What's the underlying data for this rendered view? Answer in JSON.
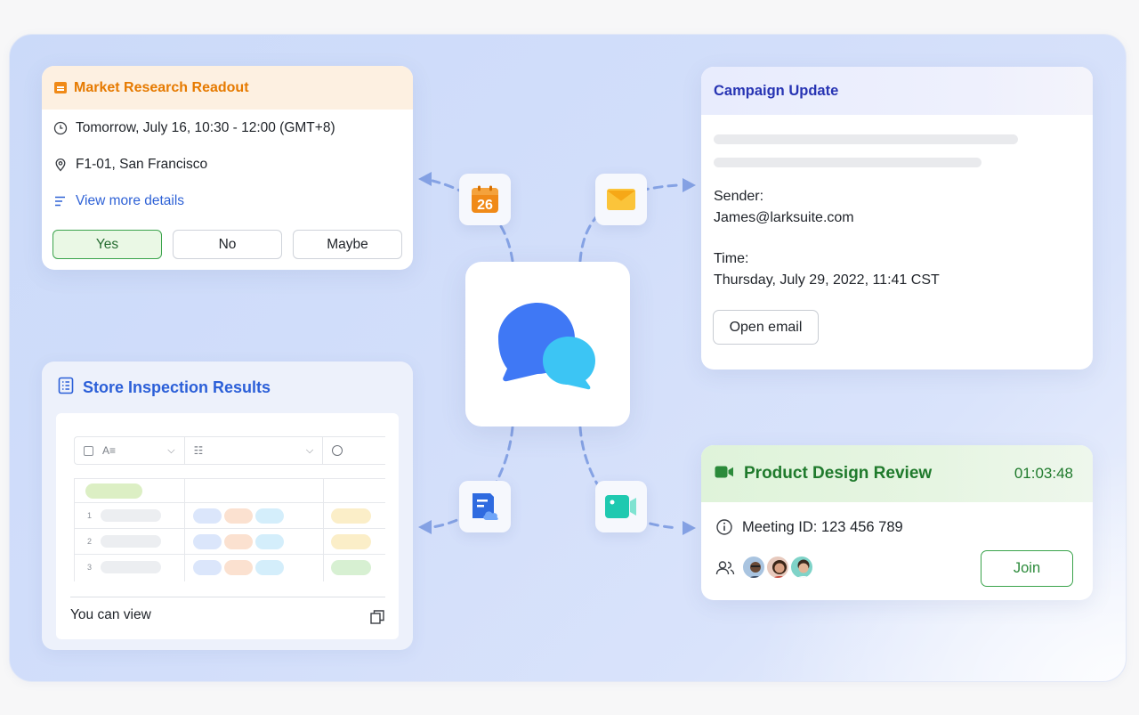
{
  "market_research": {
    "title": "Market Research Readout",
    "time": "Tomorrow, July 16, 10:30 - 12:00 (GMT+8)",
    "location": "F1-01, San Francisco",
    "details_link": "View more details",
    "buttons": {
      "yes": "Yes",
      "no": "No",
      "maybe": "Maybe"
    }
  },
  "campaign": {
    "title": "Campaign Update",
    "sender_label": "Sender:",
    "sender": "James@larksuite.com",
    "time_label": "Time:",
    "time": "Thursday, July 29, 2022, 11:41 CST",
    "open_button": "Open email"
  },
  "store_inspection": {
    "title": "Store Inspection Results",
    "row_numbers": [
      "1",
      "2",
      "3"
    ],
    "footer": "You can view"
  },
  "product_design": {
    "title": "Product Design Review",
    "timer": "01:03:48",
    "meeting_id": "Meeting ID: 123 456 789",
    "join_button": "Join"
  },
  "calendar_node": {
    "day": "26"
  },
  "icons": [
    "calendar-icon",
    "mail-icon",
    "doc-cloud-icon",
    "video-icon",
    "chat-bubbles-icon"
  ],
  "colors": {
    "orange": "#e67a00",
    "campaign_blue": "#2734b3",
    "inspection_blue": "#2b5fd8",
    "meeting_green": "#1f7a2c",
    "connector": "#7f9fe0"
  }
}
